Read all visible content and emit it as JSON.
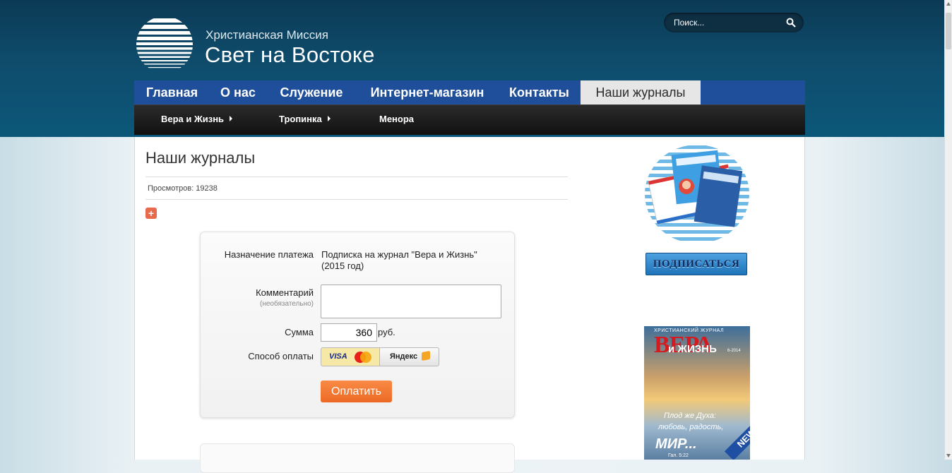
{
  "header": {
    "brand_line1": "Христианская Миссия",
    "brand_line2": "Свет на Востоке",
    "search_placeholder": "Поиск..."
  },
  "main_nav": [
    {
      "label": "Главная"
    },
    {
      "label": "О нас"
    },
    {
      "label": "Служение"
    },
    {
      "label": "Интернет-магазин"
    },
    {
      "label": "Контакты"
    },
    {
      "label": "Наши журналы"
    }
  ],
  "sub_nav": [
    {
      "label": "Вера и Жизнь"
    },
    {
      "label": "Тропинка"
    },
    {
      "label": "Менора"
    }
  ],
  "page": {
    "title": "Наши журналы",
    "views": "Просмотров: 19238",
    "plus": "+"
  },
  "payment": {
    "purpose_label": "Назначение платежа",
    "purpose_line1": "Подписка на журнал \"Вера и Жизнь\"",
    "purpose_line2": "(2015 год)",
    "comment_label": "Комментарий",
    "comment_hint": "(необязательно)",
    "amount_label": "Сумма",
    "amount_value": "360",
    "currency": "руб.",
    "method_label": "Способ оплаты",
    "method_visa": "VISA",
    "method_yandex": "Яндекс",
    "pay_button": "Оплатить"
  },
  "sidebar": {
    "subscribe_button": "ПОДПИСАТЬСЯ",
    "cover": {
      "small_title": "ХРИСТИАНСКИЙ ЖУРНАЛ",
      "title": "ВЕРА",
      "subtitle": "и ЖИЗНЬ",
      "issue": "6-2014",
      "quote1": "Плод же Духа:",
      "quote2": "любовь, радость,",
      "quote3": "МИР...",
      "ref": "Гал. 5:22",
      "band": "NEW"
    }
  },
  "colors": {
    "nav_blue": "#1f4f9a",
    "header_dark": "#0b3a55",
    "pay_orange": "#ec6a25"
  }
}
